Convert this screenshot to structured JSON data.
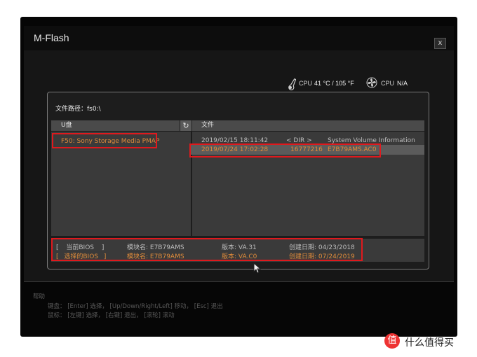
{
  "window": {
    "title": "M-Flash",
    "close_label": "x"
  },
  "status": {
    "cpu_temp_label": "CPU",
    "cpu_temp_value": "41 °C / 105 °F",
    "cpu_fan_label": "CPU",
    "cpu_fan_value": "N/A"
  },
  "dialog": {
    "path_label": "文件路径：fs0:\\",
    "drives_header": "U盘",
    "files_header": "文件",
    "drives": [
      {
        "label": "F50: Sony Storage Media PMAP"
      }
    ],
    "files": [
      {
        "datetime": "2019/02/15 18:11:42",
        "size": "< DIR >",
        "name": "System Volume Information"
      },
      {
        "datetime": "2019/07/24 17:02:28",
        "size": "16777216",
        "name": "E7B79AMS.AC0"
      }
    ],
    "bios": [
      {
        "bracket": "[ 当前BIOS ]",
        "module": "模块名: E7B79AMS",
        "version": "版本: VA.31",
        "date": "创建日期: 04/23/2018"
      },
      {
        "bracket": "[ 选择的BIOS ]",
        "module": "模块名: E7B79AMS",
        "version": "版本: VA.C0",
        "date": "创建日期: 07/24/2019"
      }
    ]
  },
  "help": {
    "title": "帮助",
    "keyboard": "键盘： [Enter] 选择， [Up/Down/Right/Left] 移动， [Esc] 退出",
    "mouse": "鼠标： [左键] 选择， [右键] 退出， [滚轮] 滚动"
  },
  "watermark": {
    "logo": "值",
    "text": "什么值得买"
  },
  "colors": {
    "accent": "#e08b3a",
    "highlight_box": "#e0191d",
    "panel": "#3a3a3a"
  },
  "icons": {
    "close": "close-icon",
    "thermometer": "thermometer-icon",
    "fan": "fan-icon",
    "refresh": "refresh-icon"
  }
}
